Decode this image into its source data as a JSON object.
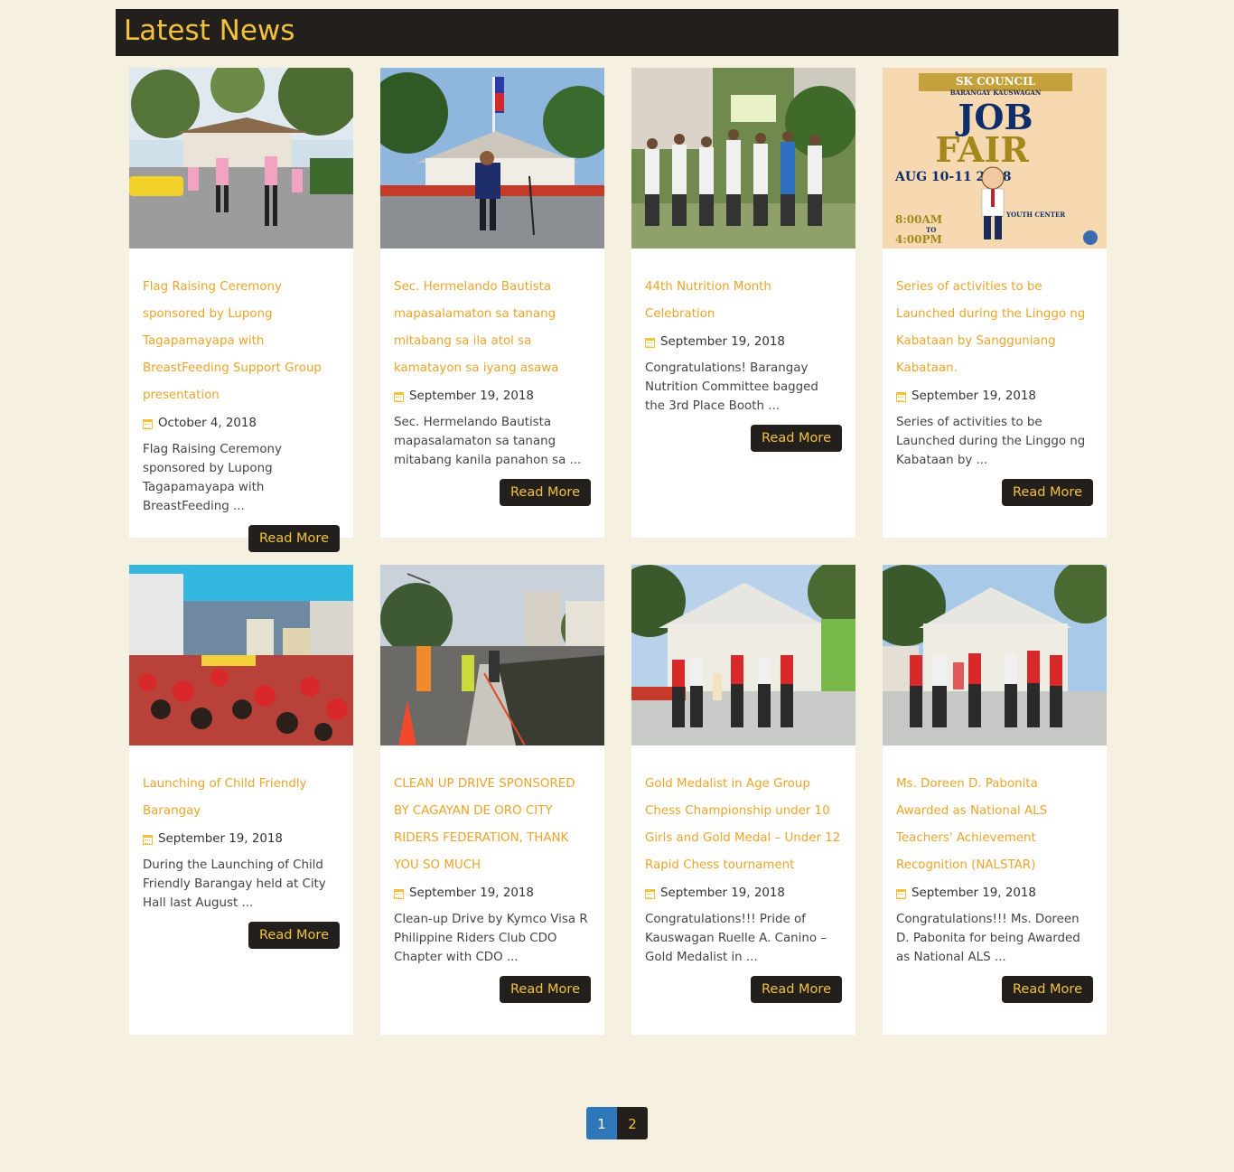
{
  "header": {
    "title": "Latest News"
  },
  "articles": [
    {
      "title": "Flag Raising Ceremony sponsored by Lupong Tagapamayapa with BreastFeeding Support Group presentation",
      "date": "October 4, 2018",
      "excerpt": "Flag Raising Ceremony sponsored by Lupong Tagapamayapa with BreastFeeding ...",
      "button": "Read More",
      "image": "photo-dancers-outdoor"
    },
    {
      "title": "Sec. Hermelando Bautista mapasalamaton sa tanang mitabang sa ila atol sa kamatayon sa iyang asawa",
      "date": "September 19, 2018",
      "excerpt": "Sec. Hermelando Bautista mapasalamaton sa tanang mitabang kanila panahon sa ...",
      "button": "Read More",
      "image": "photo-speaker-flagpole"
    },
    {
      "title": "44th Nutrition Month Celebration",
      "date": "September 19, 2018",
      "excerpt": "Congratulations! Barangay Nutrition Committee bagged the 3rd Place Booth ...",
      "button": "Read More",
      "image": "photo-group-booth"
    },
    {
      "title": "Series of activities to be Launched during the Linggo ng Kabataan by Sangguniang Kabataan.",
      "date": "September 19, 2018",
      "excerpt": "Series of activities to be Launched during the Linggo ng Kabataan by ...",
      "button": "Read More",
      "image": "poster-job-fair",
      "poster": {
        "header": "SK COUNCIL",
        "subheader": "BARANGAY KAUSWAGAN",
        "line1": "JOB",
        "line2": "FAIR",
        "dates": "AUG 10-11 2018",
        "time1": "8:00AM",
        "time_to": "TO",
        "time2": "4:00PM",
        "venue": "AT 2F YOUTH CENTER"
      }
    },
    {
      "title": "Launching of Child Friendly Barangay",
      "date": "September 19, 2018",
      "excerpt": "During the Launching of Child Friendly Barangay held at City Hall last August ...",
      "button": "Read More",
      "image": "photo-crowd-stage"
    },
    {
      "title": "CLEAN UP DRIVE SPONSORED BY CAGAYAN DE ORO CITY RIDERS FEDERATION, THANK YOU SO MUCH",
      "date": "September 19, 2018",
      "excerpt": "Clean-up Drive by Kymco Visa R Philippine Riders Club CDO Chapter with CDO ...",
      "button": "Read More",
      "image": "photo-canal-cleanup"
    },
    {
      "title": "Gold Medalist in Age Group Chess Championship under 10 Girls and Gold Medal – Under 12 Rapid Chess tournament",
      "date": "September 19, 2018",
      "excerpt": "Congratulations!!! Pride of Kauswagan Ruelle A. Canino – Gold Medalist in ...",
      "button": "Read More",
      "image": "photo-group-hall-a"
    },
    {
      "title": "Ms. Doreen D. Pabonita Awarded as National ALS Teachers' Achievement Recognition (NALSTAR)",
      "date": "September 19, 2018",
      "excerpt": "Congratulations!!! Ms. Doreen D. Pabonita for being Awarded as National ALS ...",
      "button": "Read More",
      "image": "photo-group-hall-b"
    }
  ],
  "pagination": {
    "pages": [
      "1",
      "2"
    ],
    "current": "1"
  }
}
